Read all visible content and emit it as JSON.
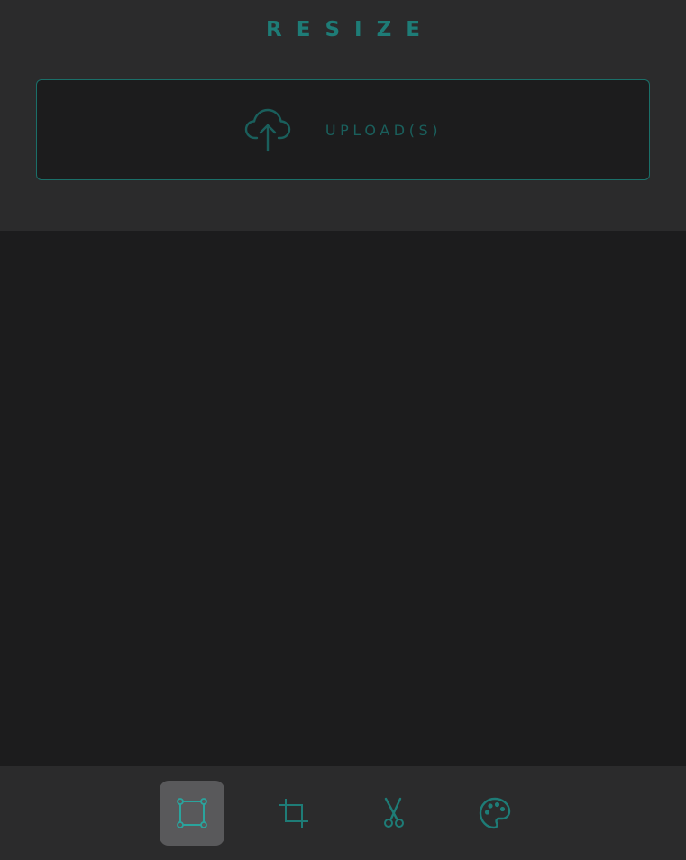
{
  "header": {
    "title": "RESIZE"
  },
  "upload": {
    "label": "UPLOAD(S)",
    "icon": "cloud-upload-icon"
  },
  "toolbar": {
    "tools": [
      {
        "name": "resize",
        "icon": "resize-square-icon",
        "active": true
      },
      {
        "name": "crop",
        "icon": "crop-icon",
        "active": false
      },
      {
        "name": "cut",
        "icon": "scissors-icon",
        "active": false
      },
      {
        "name": "color",
        "icon": "palette-icon",
        "active": false
      }
    ]
  },
  "colors": {
    "accent": "#1e7c77",
    "header_bg": "#2b2b2c",
    "content_bg": "#1c1c1d",
    "active_tool_bg": "#59595b"
  }
}
